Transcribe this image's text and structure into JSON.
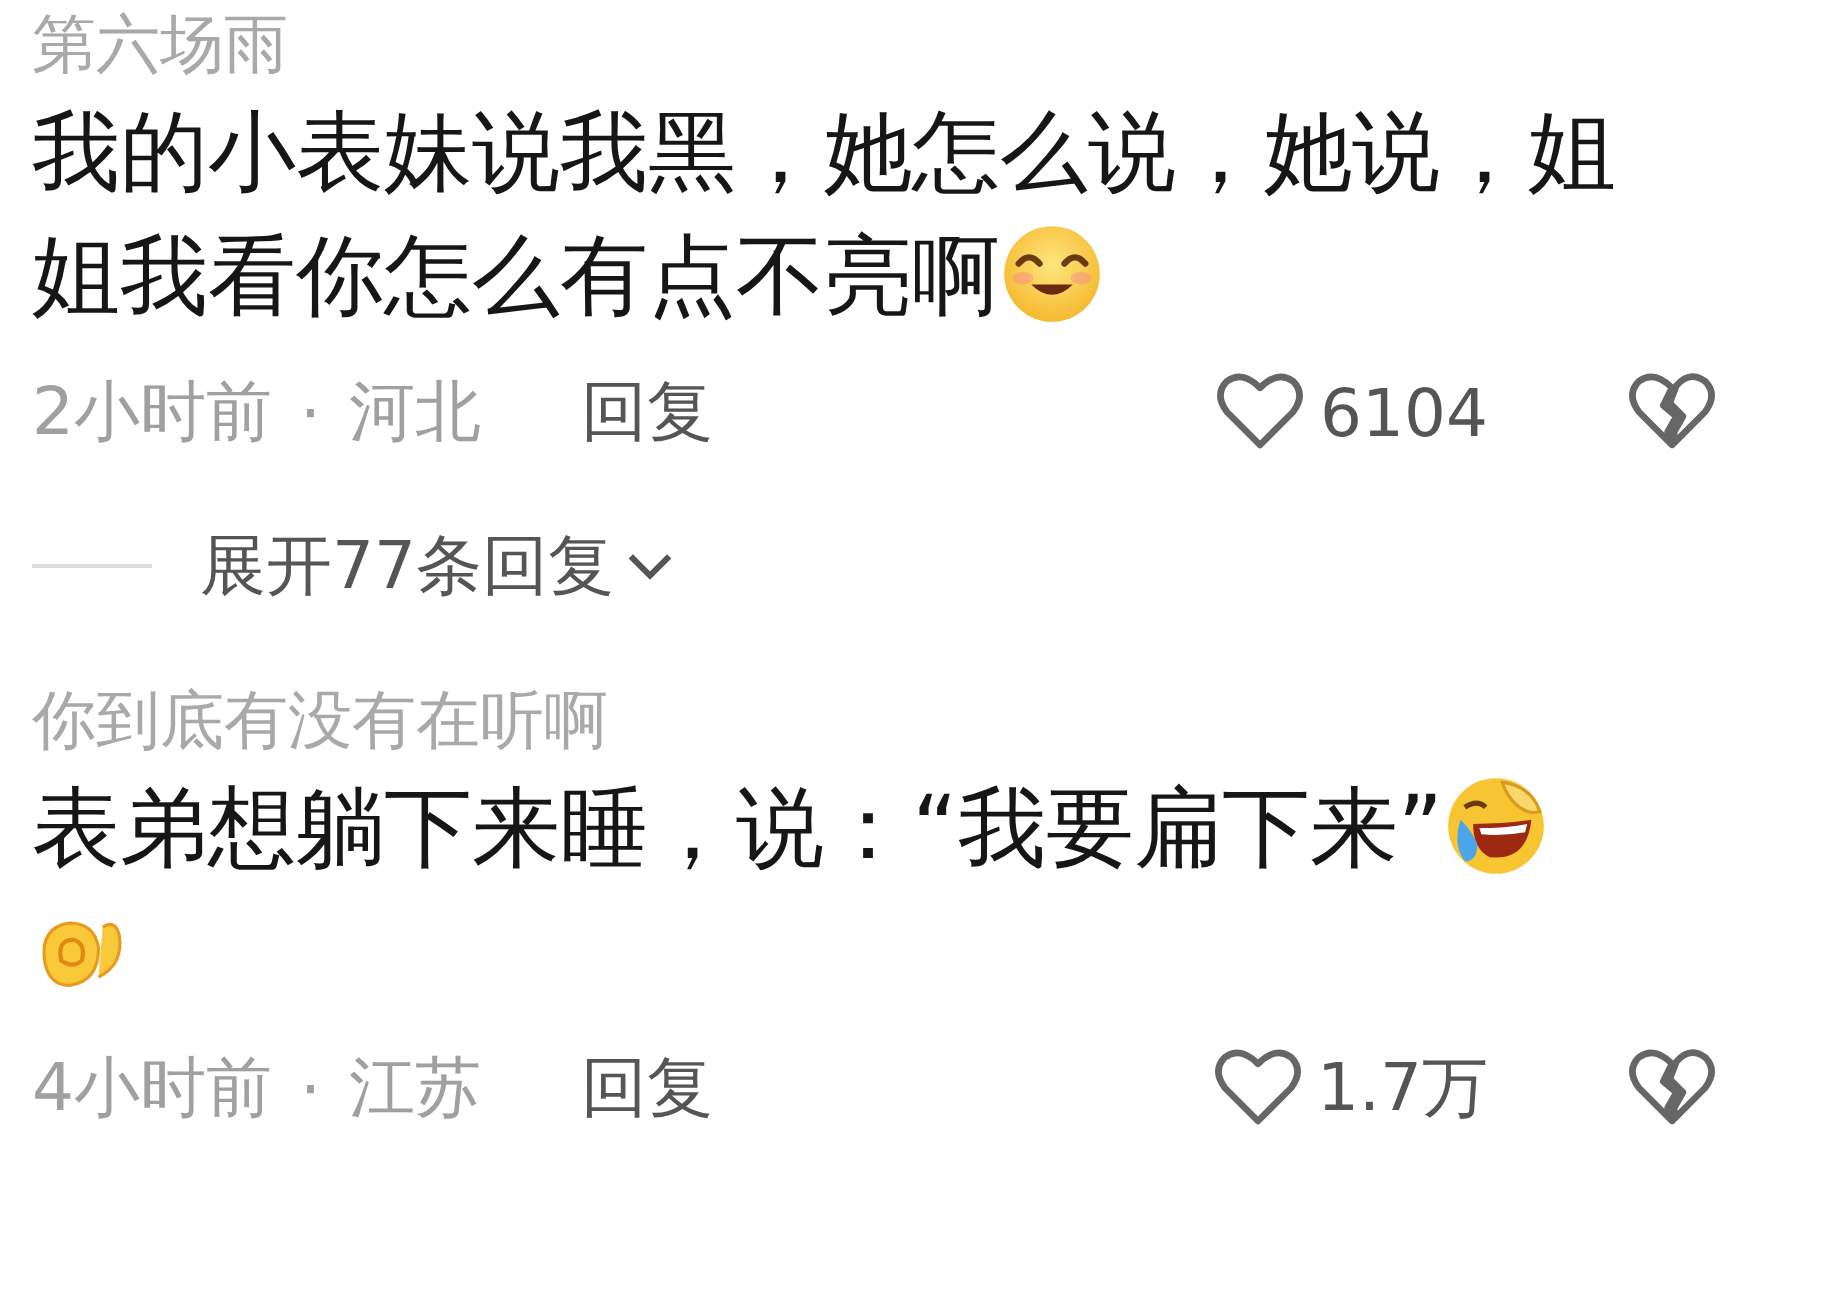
{
  "comments": [
    {
      "username": "第六场雨",
      "lines": [
        {
          "text": "我的小表妹说我黑，她怎么说，她说，姐"
        },
        {
          "text": "姐我看你怎么有点不亮啊",
          "emojis": [
            {
              "kind": "smile"
            }
          ]
        }
      ],
      "time": "2小时前",
      "separator": "·",
      "location": "河北",
      "reply": "回复",
      "likes": "6104",
      "liked": false,
      "expand": "展开77条回复"
    },
    {
      "username": "你到底有没有在听啊",
      "lines": [
        {
          "text": "表弟想躺下来睡，说：“我要扁下来”",
          "emojis": [
            {
              "kind": "laugh-cry"
            }
          ]
        },
        {
          "emojis": [
            {
              "kind": "fist"
            }
          ]
        }
      ],
      "time": "4小时前",
      "separator": "·",
      "location": "江苏",
      "reply": "回复",
      "likes": "1.7万",
      "liked": false
    }
  ]
}
